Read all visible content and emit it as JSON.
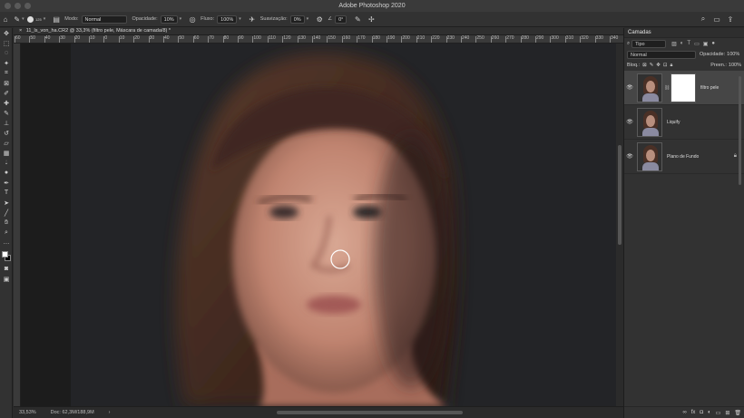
{
  "window": {
    "title": "Adobe Photoshop 2020"
  },
  "options_bar": {
    "brush_size": "125",
    "mode_label": "Modo:",
    "mode_value": "Normal",
    "opacity_label": "Opacidade:",
    "opacity_value": "10%",
    "flow_label": "Fluxo:",
    "flow_value": "100%",
    "smoothing_label": "Suavização:",
    "smoothing_value": "0%",
    "angle_value": "0°"
  },
  "document": {
    "tab_title": "11_ls_von_ha.CR2 @ 33,3% (filtro pele, Máscara de camada/8) *",
    "ruler_ticks": [
      "60",
      "50",
      "40",
      "30",
      "20",
      "10",
      "0",
      "10",
      "20",
      "30",
      "40",
      "50",
      "60",
      "70",
      "80",
      "90",
      "100",
      "110",
      "120",
      "130",
      "140",
      "150",
      "160",
      "170",
      "180",
      "190",
      "200",
      "210",
      "220",
      "230",
      "240",
      "250",
      "260",
      "270",
      "280",
      "290",
      "300",
      "310",
      "320",
      "330",
      "340",
      "350",
      "36"
    ]
  },
  "status_bar": {
    "zoom": "33,53%",
    "doc_info": "Doc: 62,3M/188,9M",
    "arrow": "›"
  },
  "layers_panel": {
    "tab_label": "Camadas",
    "filter_kind": "Tipo",
    "blend_mode": "Normal",
    "opacity_label": "Opacidade:",
    "opacity_value": "100%",
    "lock_label": "Bloq.:",
    "fill_label": "Preen.:",
    "fill_value": "100%",
    "layers": [
      {
        "name": "filtro pele",
        "has_mask": true,
        "selected": true
      },
      {
        "name": "Liquify",
        "has_mask": false,
        "selected": false
      },
      {
        "name": "Plano de Fundo",
        "has_mask": false,
        "selected": false,
        "locked": true
      }
    ]
  },
  "colors": {
    "foreground": "#ffffff",
    "background": "#000000",
    "accent": "#464646"
  }
}
